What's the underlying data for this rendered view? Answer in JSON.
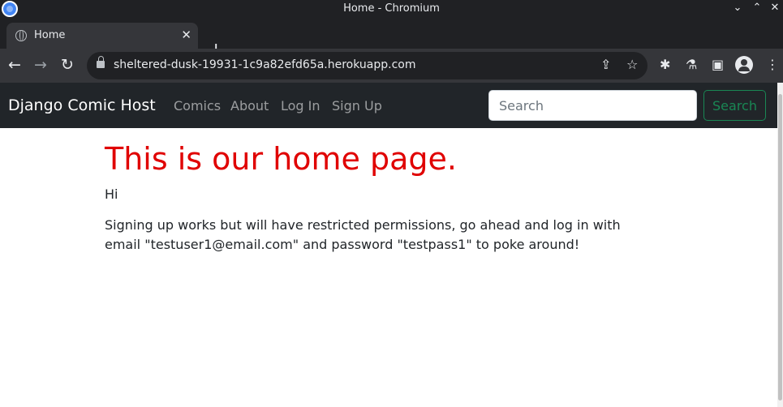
{
  "window": {
    "title": "Home - Chromium",
    "controls": {
      "minimize": "⌄",
      "maximize": "⌃",
      "close": "✕"
    }
  },
  "tabs": [
    {
      "label": "Home",
      "icon": "globe-icon",
      "close": "✕"
    }
  ],
  "tabstrip": {
    "new_tab": "+",
    "menu": "⌄"
  },
  "toolbar": {
    "back": "←",
    "forward": "→",
    "reload": "↻",
    "url": "sheltered-dusk-19931-1c9a82efd65a.herokuapp.com",
    "share": "⇪",
    "star": "☆",
    "extensions": "✱",
    "lab": "⚗",
    "sidepanel": "▣",
    "menu": "⋮"
  },
  "site": {
    "brand": "Django Comic Host",
    "nav": [
      {
        "label": "Comics"
      },
      {
        "label": "About"
      },
      {
        "label": "Log In"
      },
      {
        "label": "Sign Up"
      }
    ],
    "search": {
      "placeholder": "Search",
      "value": "",
      "button": "Search"
    }
  },
  "main": {
    "heading": "This is our home page.",
    "greeting": "Hi",
    "message": "Signing up works but will have restricted permissions, go ahead and log in with email \"testuser1@email.com\" and password \"testpass1\" to poke around!"
  },
  "colors": {
    "heading": "#e00000",
    "navbar": "#212529",
    "search_button": "#198754",
    "browser_dark": "#202124",
    "browser_toolbar": "#35363a"
  }
}
